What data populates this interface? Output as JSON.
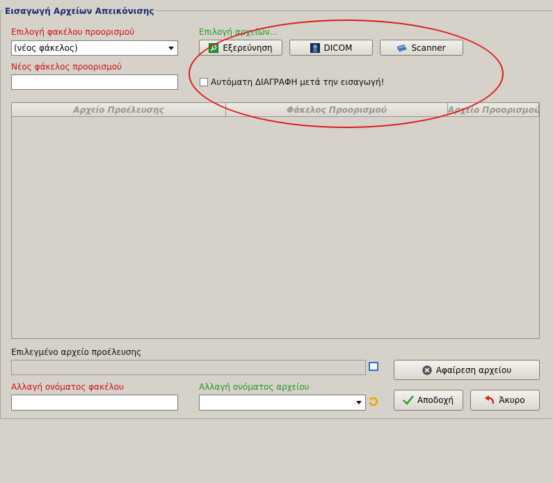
{
  "window": {
    "group_title": "Εισαγωγή Αρχείων Απεικόνισης"
  },
  "dest_folder": {
    "label": "Επιλογή φακέλου προορισμού",
    "value": "(νέος φάκελος)",
    "new_label": "Νέος φάκελος προορισμού",
    "new_value": ""
  },
  "file_select": {
    "label": "Επιλογή αρχείων...",
    "explore_label": "Εξερεύνηση",
    "dicom_label": "DICOM",
    "scanner_label": "Scanner",
    "auto_delete_label": "Αυτόματη ΔΙΑΓΡΑΦΗ μετά την εισαγωγή!",
    "auto_delete_checked": false
  },
  "table": {
    "columns": [
      "Αρχείο Προέλευσης",
      "Φάκελος Προορισμού",
      "Αρχείο Προορισμού"
    ],
    "rows": []
  },
  "selected_source": {
    "label": "Επιλεγμένο αρχείο προέλευσης",
    "value": ""
  },
  "rename_folder": {
    "label": "Αλλαγή ονόματος φακέλου",
    "value": ""
  },
  "rename_file": {
    "label": "Αλλαγή ονόματος αρχείου",
    "value": ""
  },
  "actions": {
    "remove_label": "Αφαίρεση αρχείου",
    "accept_label": "Αποδοχή",
    "cancel_label": "Άκυρο"
  },
  "colors": {
    "annotation": "#e01818",
    "title": "#1c2e6e",
    "required_label": "#cc1111",
    "optional_label": "#229922"
  }
}
